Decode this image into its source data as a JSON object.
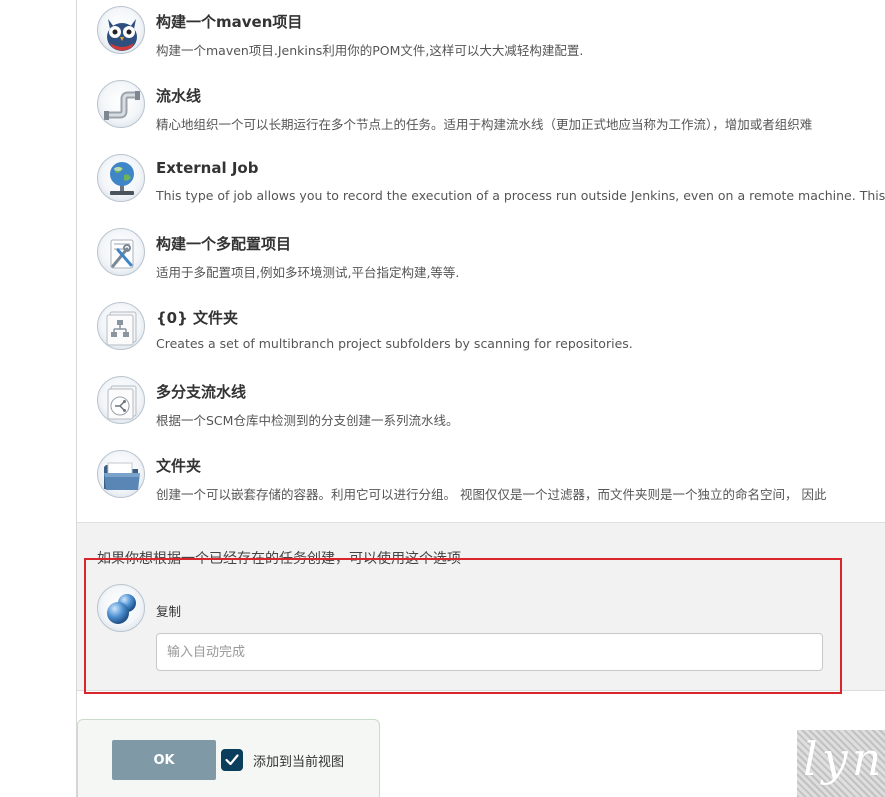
{
  "job_types": [
    {
      "icon": "maven-owl-icon",
      "title": "构建一个maven项目",
      "description": "构建一个maven项目.Jenkins利用你的POM文件,这样可以大大减轻构建配置."
    },
    {
      "icon": "pipeline-pipe-icon",
      "title": "流水线",
      "description": "精心地组织一个可以长期运行在多个节点上的任务。适用于构建流水线（更加正式地应当称为工作流），增加或者组织难"
    },
    {
      "icon": "external-job-globe-icon",
      "title": "External Job",
      "description": "This type of job allows you to record the execution of a process run outside Jenkins, even on a remote machine. This is des"
    },
    {
      "icon": "multi-config-tools-icon",
      "title": "构建一个多配置项目",
      "description": "适用于多配置项目,例如多环境测试,平台指定构建,等等."
    },
    {
      "icon": "org-folder-icon",
      "title": "{0} 文件夹",
      "description": "Creates a set of multibranch project subfolders by scanning for repositories."
    },
    {
      "icon": "multibranch-pipeline-icon",
      "title": "多分支流水线",
      "description": "根据一个SCM仓库中检测到的分支创建一系列流水线。"
    },
    {
      "icon": "folder-icon",
      "title": "文件夹",
      "description": "创建一个可以嵌套存储的容器。利用它可以进行分组。 视图仅仅是一个过滤器，而文件夹则是一个独立的命名空间， 因此"
    }
  ],
  "copy_section": {
    "hint": "如果你想根据一个已经存在的任务创建，可以使用这个选项",
    "icon": "copy-spheres-icon",
    "label": "复制",
    "input_value": "",
    "input_placeholder": "输入自动完成"
  },
  "bottom_bar": {
    "ok_label": "OK",
    "add_to_view_label": "添加到当前视图",
    "add_to_view_checked": true
  },
  "watermark": {
    "text": "lyn"
  },
  "colors": {
    "highlight_box": "#d9262c",
    "ok_button": "#7f9aa6",
    "checkbox": "#0b3d5c",
    "copy_section_background": "#f2f2f2"
  }
}
